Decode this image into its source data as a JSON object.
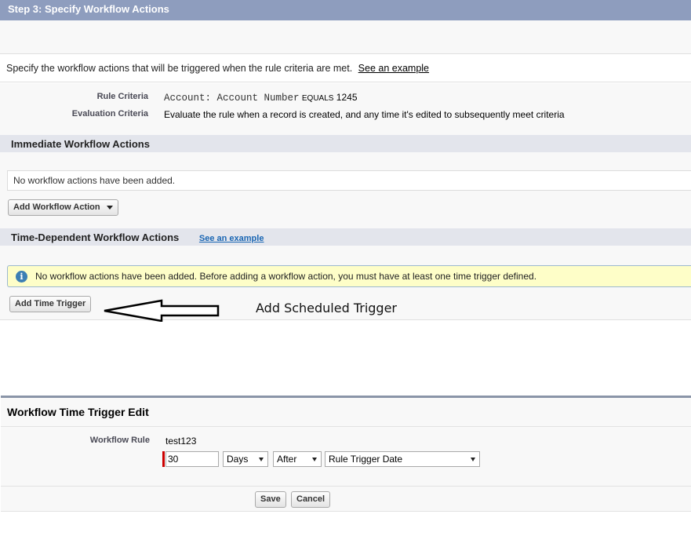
{
  "step_header": "Step 3: Specify Workflow Actions",
  "intro": {
    "text": "Specify the workflow actions that will be triggered when the rule criteria are met.",
    "link": "See an example"
  },
  "criteria": {
    "rule_label": "Rule Criteria",
    "rule_field": "Account: Account Number",
    "rule_operator": "EQUALS",
    "rule_value": "1245",
    "eval_label": "Evaluation Criteria",
    "eval_value": "Evaluate the rule when a record is created, and any time it's edited to subsequently meet criteria"
  },
  "immediate": {
    "title": "Immediate Workflow Actions",
    "empty_text": "No workflow actions have been added.",
    "add_button": "Add Workflow Action"
  },
  "time_dependent": {
    "title": "Time-Dependent Workflow Actions",
    "link": "See an example",
    "info_text": "No workflow actions have been added. Before adding a workflow action, you must have at least one time trigger defined.",
    "add_button": "Add Time Trigger"
  },
  "annotation": "Add Scheduled Trigger",
  "time_trigger_edit": {
    "title": "Workflow Time Trigger Edit",
    "rule_label": "Workflow Rule",
    "rule_value": "test123",
    "amount": "30",
    "unit": "Days",
    "direction": "After",
    "date_field": "Rule Trigger Date",
    "save": "Save",
    "cancel": "Cancel"
  },
  "colors": {
    "header_bg": "#8e9dbe",
    "section_bg": "#e3e5ec",
    "info_bg": "#fefec8",
    "info_icon": "#3c7fb4",
    "link": "#1a66b3",
    "required": "#cc0000"
  },
  "icons": {
    "info": "info-circle-icon",
    "dropdown": "chevron-down-icon",
    "annotation_arrow": "left-arrow-icon"
  }
}
